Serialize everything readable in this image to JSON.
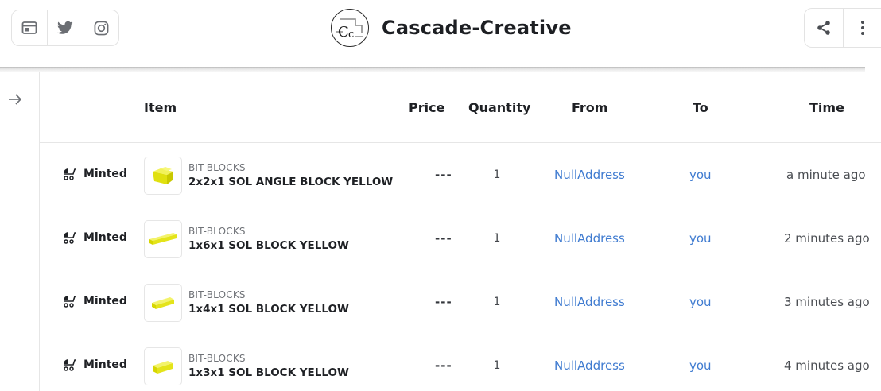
{
  "header": {
    "social": [
      {
        "name": "website-icon",
        "label": "Website"
      },
      {
        "name": "twitter-icon",
        "label": "Twitter"
      },
      {
        "name": "instagram-icon",
        "label": "Instagram"
      }
    ],
    "brand_name": "Cascade-Creative",
    "logo_icon": "cascade-creative-logo",
    "actions": [
      {
        "name": "share-icon"
      },
      {
        "name": "more-vertical-icon"
      }
    ]
  },
  "sidebar": {
    "expand_icon": "arrow-right-icon"
  },
  "table": {
    "columns": {
      "item": "Item",
      "price": "Price",
      "quantity": "Quantity",
      "from": "From",
      "to": "To",
      "time": "Time"
    },
    "rows": [
      {
        "event": "Minted",
        "collection": "BIT-BLOCKS",
        "item": "2x2x1 SOL ANGLE BLOCK YELLOW",
        "price": "---",
        "quantity": "1",
        "from": "NullAddress",
        "to": "you",
        "time": "a minute ago"
      },
      {
        "event": "Minted",
        "collection": "BIT-BLOCKS",
        "item": "1x6x1 SOL BLOCK YELLOW",
        "price": "---",
        "quantity": "1",
        "from": "NullAddress",
        "to": "you",
        "time": "2 minutes ago"
      },
      {
        "event": "Minted",
        "collection": "BIT-BLOCKS",
        "item": "1x4x1 SOL BLOCK YELLOW",
        "price": "---",
        "quantity": "1",
        "from": "NullAddress",
        "to": "you",
        "time": "3 minutes ago"
      },
      {
        "event": "Minted",
        "collection": "BIT-BLOCKS",
        "item": "1x3x1 SOL BLOCK YELLOW",
        "price": "---",
        "quantity": "1",
        "from": "NullAddress",
        "to": "you",
        "time": "4 minutes ago"
      }
    ]
  },
  "colors": {
    "link": "#3f7bd0",
    "block_yellow": "#e6e61a",
    "text": "#1f2125",
    "border": "#e3e3e3"
  }
}
